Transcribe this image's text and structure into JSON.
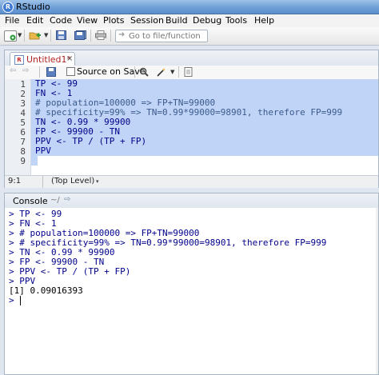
{
  "window": {
    "title": "RStudio"
  },
  "menu": [
    "File",
    "Edit",
    "Code",
    "View",
    "Plots",
    "Session",
    "Build",
    "Debug",
    "Tools",
    "Help"
  ],
  "toolbar": {
    "goto_placeholder": "Go to file/function"
  },
  "editor": {
    "tab_label": "Untitled1*",
    "tab_close": "×",
    "source_on_save_label": "Source on Save",
    "source_on_save_checked": false,
    "lines": [
      {
        "num": "1",
        "text": "TP <- 99",
        "kind": "code"
      },
      {
        "num": "2",
        "text": "FN <- 1",
        "kind": "code"
      },
      {
        "num": "3",
        "text": "# population=100000 => FP+TN=99000",
        "kind": "comment"
      },
      {
        "num": "4",
        "text": "# specificity=99% => TN=0.99*99000=98901, therefore FP=999",
        "kind": "comment"
      },
      {
        "num": "5",
        "text": "TN <- 0.99 * 99900",
        "kind": "code"
      },
      {
        "num": "6",
        "text": "FP <- 99900 - TN",
        "kind": "code"
      },
      {
        "num": "7",
        "text": "PPV <- TP / (TP + FP)",
        "kind": "code"
      },
      {
        "num": "8",
        "text": "PPV",
        "kind": "code"
      },
      {
        "num": "9",
        "text": "",
        "kind": "code"
      }
    ],
    "status_position": "9:1",
    "status_scope": "(Top Level)",
    "status_scope_dropdown": "▾"
  },
  "console": {
    "title": "Console",
    "path": "~/",
    "path_icon": "arrow-icon",
    "lines": [
      {
        "text": "> TP <- 99",
        "kind": "input"
      },
      {
        "text": "> FN <- 1",
        "kind": "input"
      },
      {
        "text": "> # population=100000 => FP+TN=99000",
        "kind": "input"
      },
      {
        "text": "> # specificity=99% => TN=0.99*99000=98901, therefore FP=999",
        "kind": "input"
      },
      {
        "text": "> TN <- 0.99 * 99900",
        "kind": "input"
      },
      {
        "text": "> FP <- 99900 - TN",
        "kind": "input"
      },
      {
        "text": "> PPV <- TP / (TP + FP)",
        "kind": "input"
      },
      {
        "text": "> PPV",
        "kind": "input"
      },
      {
        "text": "[1] 0.09016393",
        "kind": "output"
      },
      {
        "text": ">",
        "kind": "input"
      }
    ]
  },
  "colors": {
    "code": "#00008b",
    "selection": "#bfd4f6",
    "tab_text": "#b22222"
  }
}
